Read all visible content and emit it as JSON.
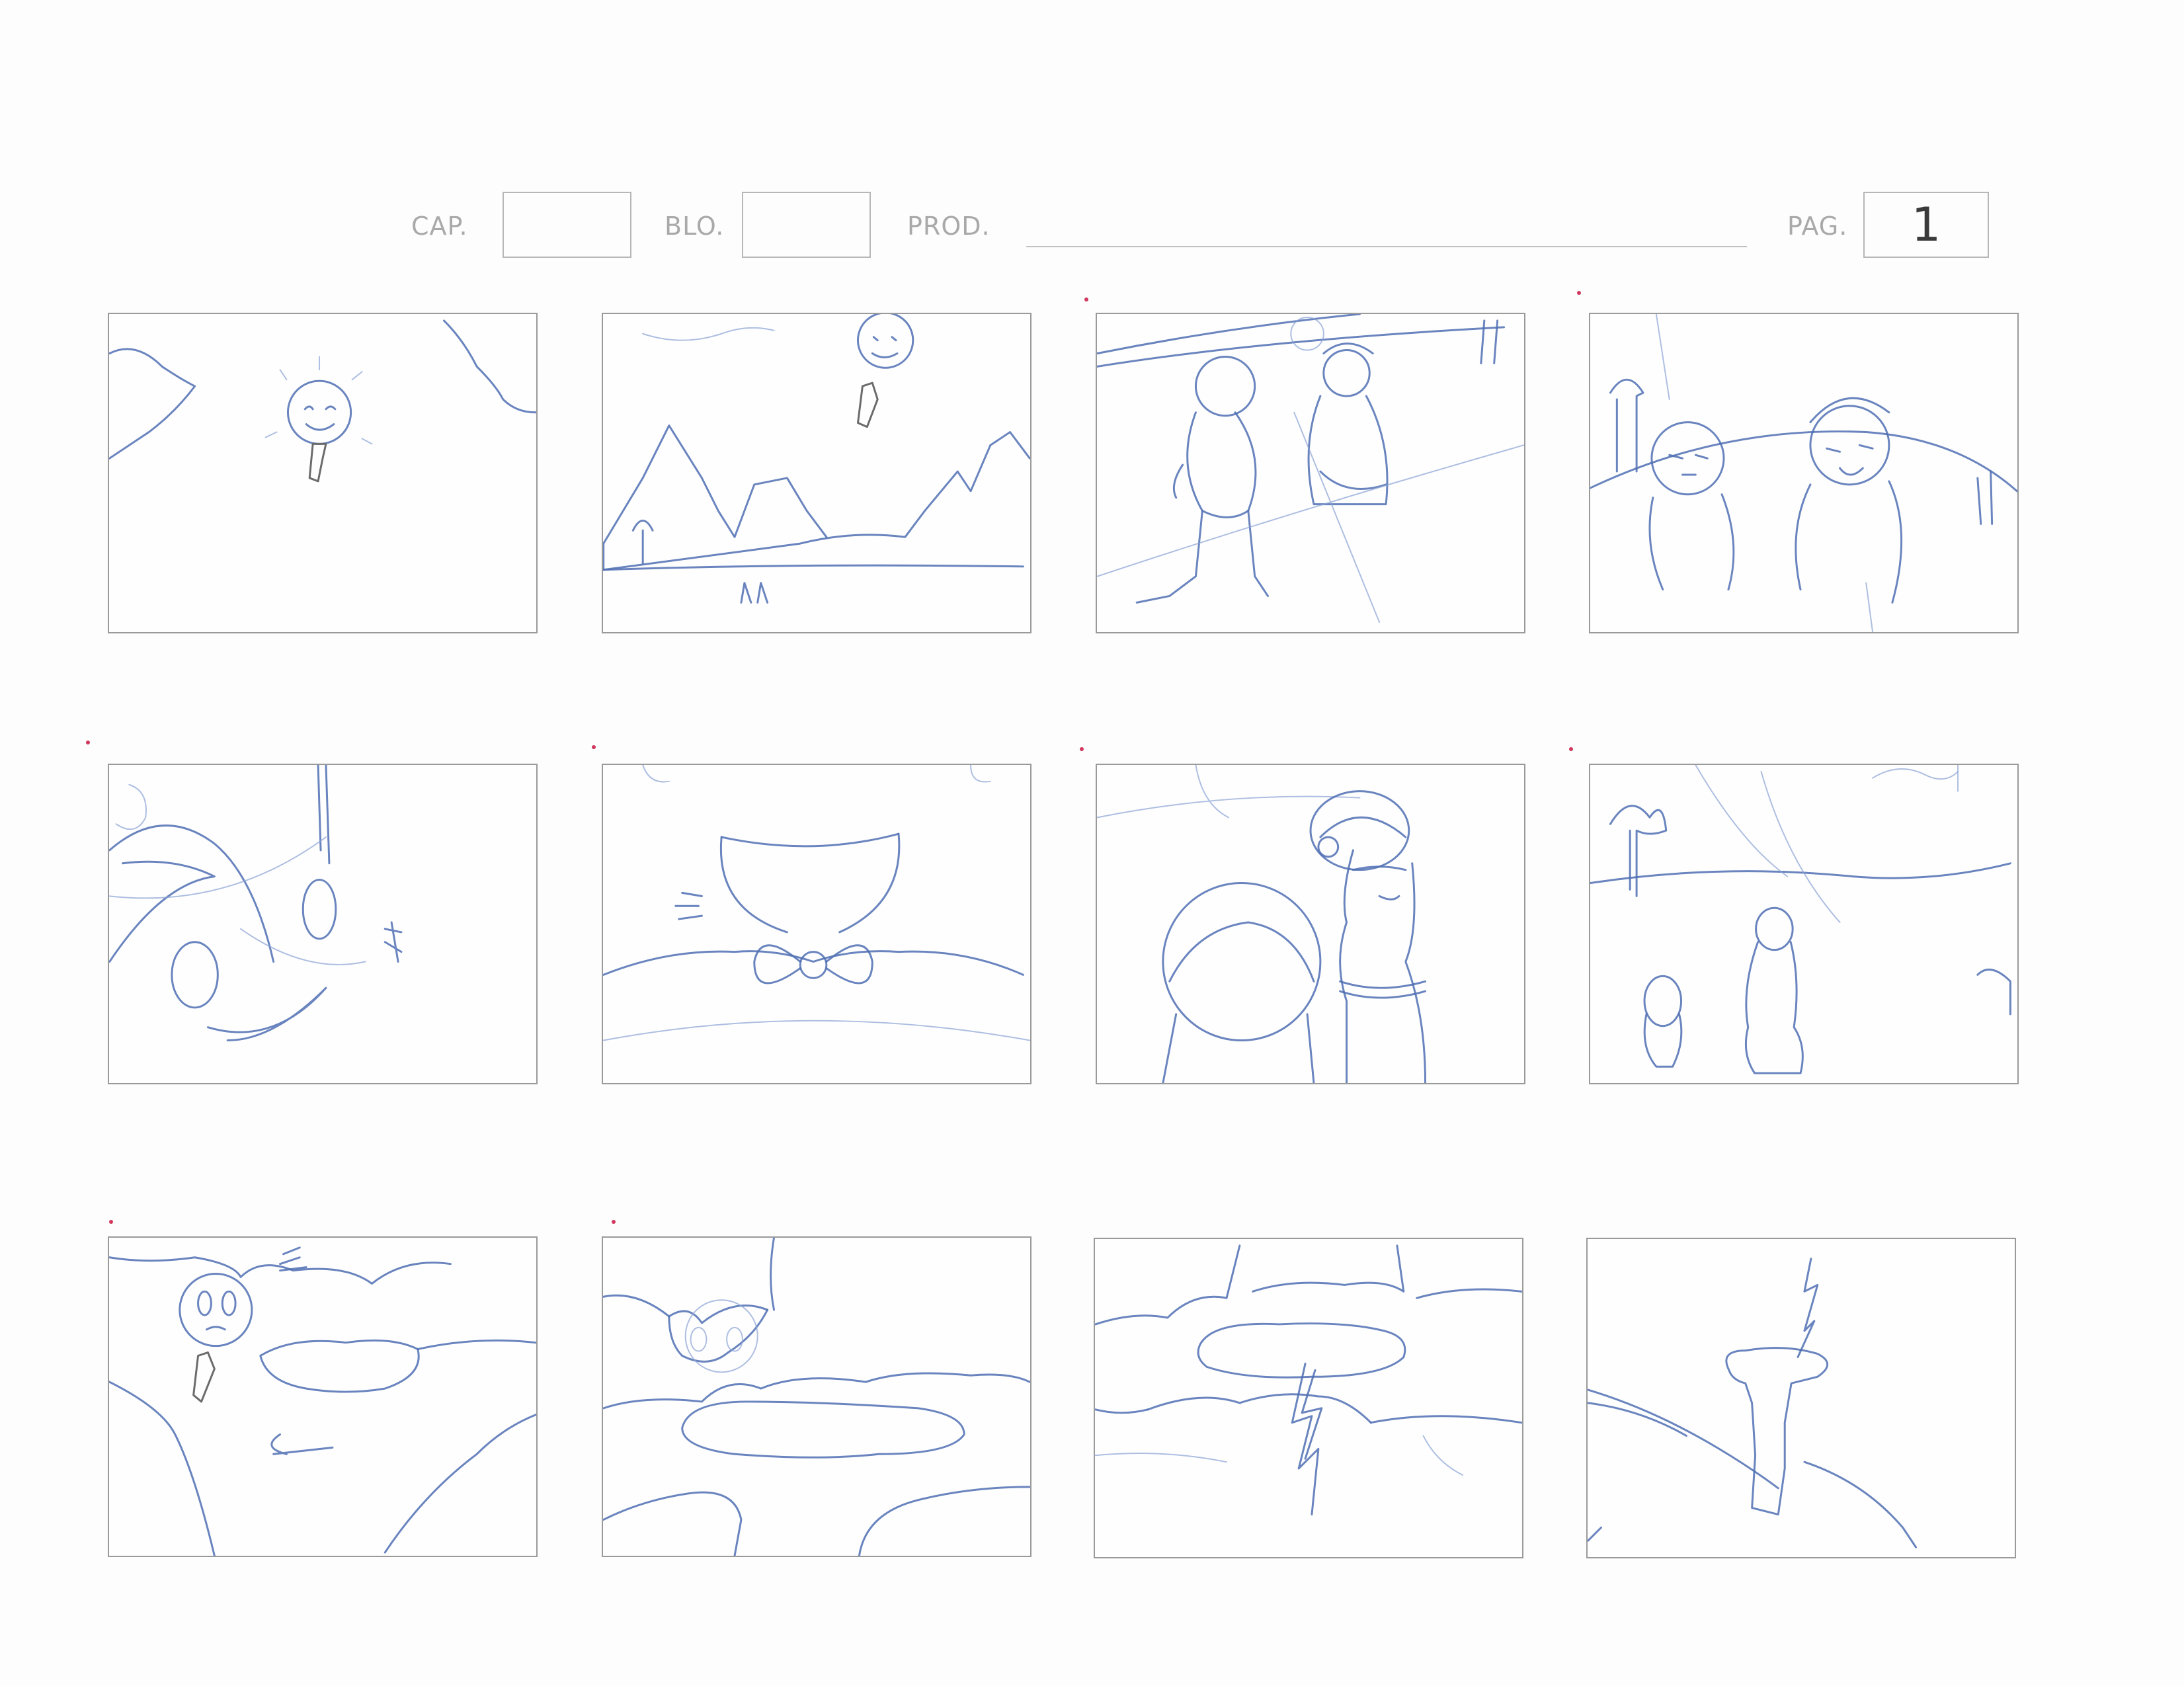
{
  "header": {
    "cap_label": "CAP.",
    "blo_label": "BLO.",
    "prod_label": "PROD.",
    "pag_label": "PAG.",
    "page_number": "1"
  },
  "panels": [
    {
      "content": "sun-with-tie-icon"
    },
    {
      "content": "landscape-with-hills-and-sun-icon"
    },
    {
      "content": "two-characters-walking-icon"
    },
    {
      "content": "two-characters-talking-icon"
    },
    {
      "content": "closeup-smiling-face-icon"
    },
    {
      "content": "closeup-mouth-and-bowtie-icon"
    },
    {
      "content": "two-characters-closeup-icon"
    },
    {
      "content": "two-small-characters-with-trees-icon"
    },
    {
      "content": "worried-sun-among-clouds-icon"
    },
    {
      "content": "sun-over-cloud-icon"
    },
    {
      "content": "lightning-from-cloud-icon"
    },
    {
      "content": "lightning-hitting-tree-icon"
    }
  ]
}
